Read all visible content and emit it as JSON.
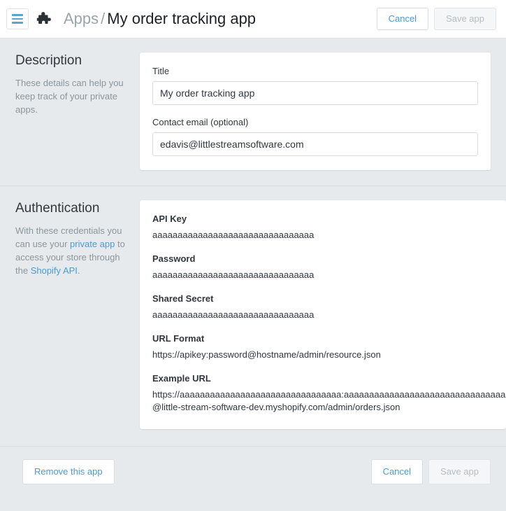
{
  "topbar": {
    "menu_icon": "hamburger-menu-icon",
    "app_icon": "puzzle-piece-icon",
    "breadcrumb_parent": "Apps",
    "breadcrumb_separator": "/",
    "breadcrumb_current": "My order tracking app",
    "cancel_label": "Cancel",
    "save_label": "Save app"
  },
  "description_section": {
    "heading": "Description",
    "help_text": "These details can help you keep track of your private apps.",
    "title_field": {
      "label": "Title",
      "value": "My order tracking app",
      "placeholder": ""
    },
    "email_field": {
      "label": "Contact email (optional)",
      "value": "edavis@littlestreamsoftware.com",
      "placeholder": ""
    }
  },
  "authentication_section": {
    "heading": "Authentication",
    "help_text_part1": "With these credentials you can use your ",
    "help_link1": "private app",
    "help_text_part2": " to access your store through the ",
    "help_link2": "Shopify API",
    "help_text_part3": ".",
    "credentials": [
      {
        "label": "API Key",
        "value": "aaaaaaaaaaaaaaaaaaaaaaaaaaaaaaaa"
      },
      {
        "label": "Password",
        "value": "aaaaaaaaaaaaaaaaaaaaaaaaaaaaaaaa"
      },
      {
        "label": "Shared Secret",
        "value": "aaaaaaaaaaaaaaaaaaaaaaaaaaaaaaaa"
      },
      {
        "label": "URL Format",
        "value": "https://apikey:password@hostname/admin/resource.json"
      },
      {
        "label": "Example URL",
        "value": "https://aaaaaaaaaaaaaaaaaaaaaaaaaaaaaaaa:aaaaaaaaaaaaaaaaaaaaaaaaaaaaaaaa@little-stream-software-dev.myshopify.com/admin/orders.json"
      }
    ]
  },
  "footer": {
    "remove_label": "Remove this app",
    "cancel_label": "Cancel",
    "save_label": "Save app"
  },
  "colors": {
    "page_background": "#e7eaec",
    "card_background": "#ffffff",
    "accent_link": "#4a9ad4",
    "text_primary": "#31373d",
    "text_muted": "#8b959c",
    "border": "#d9dde0",
    "disabled_text": "#b6bdc3"
  }
}
